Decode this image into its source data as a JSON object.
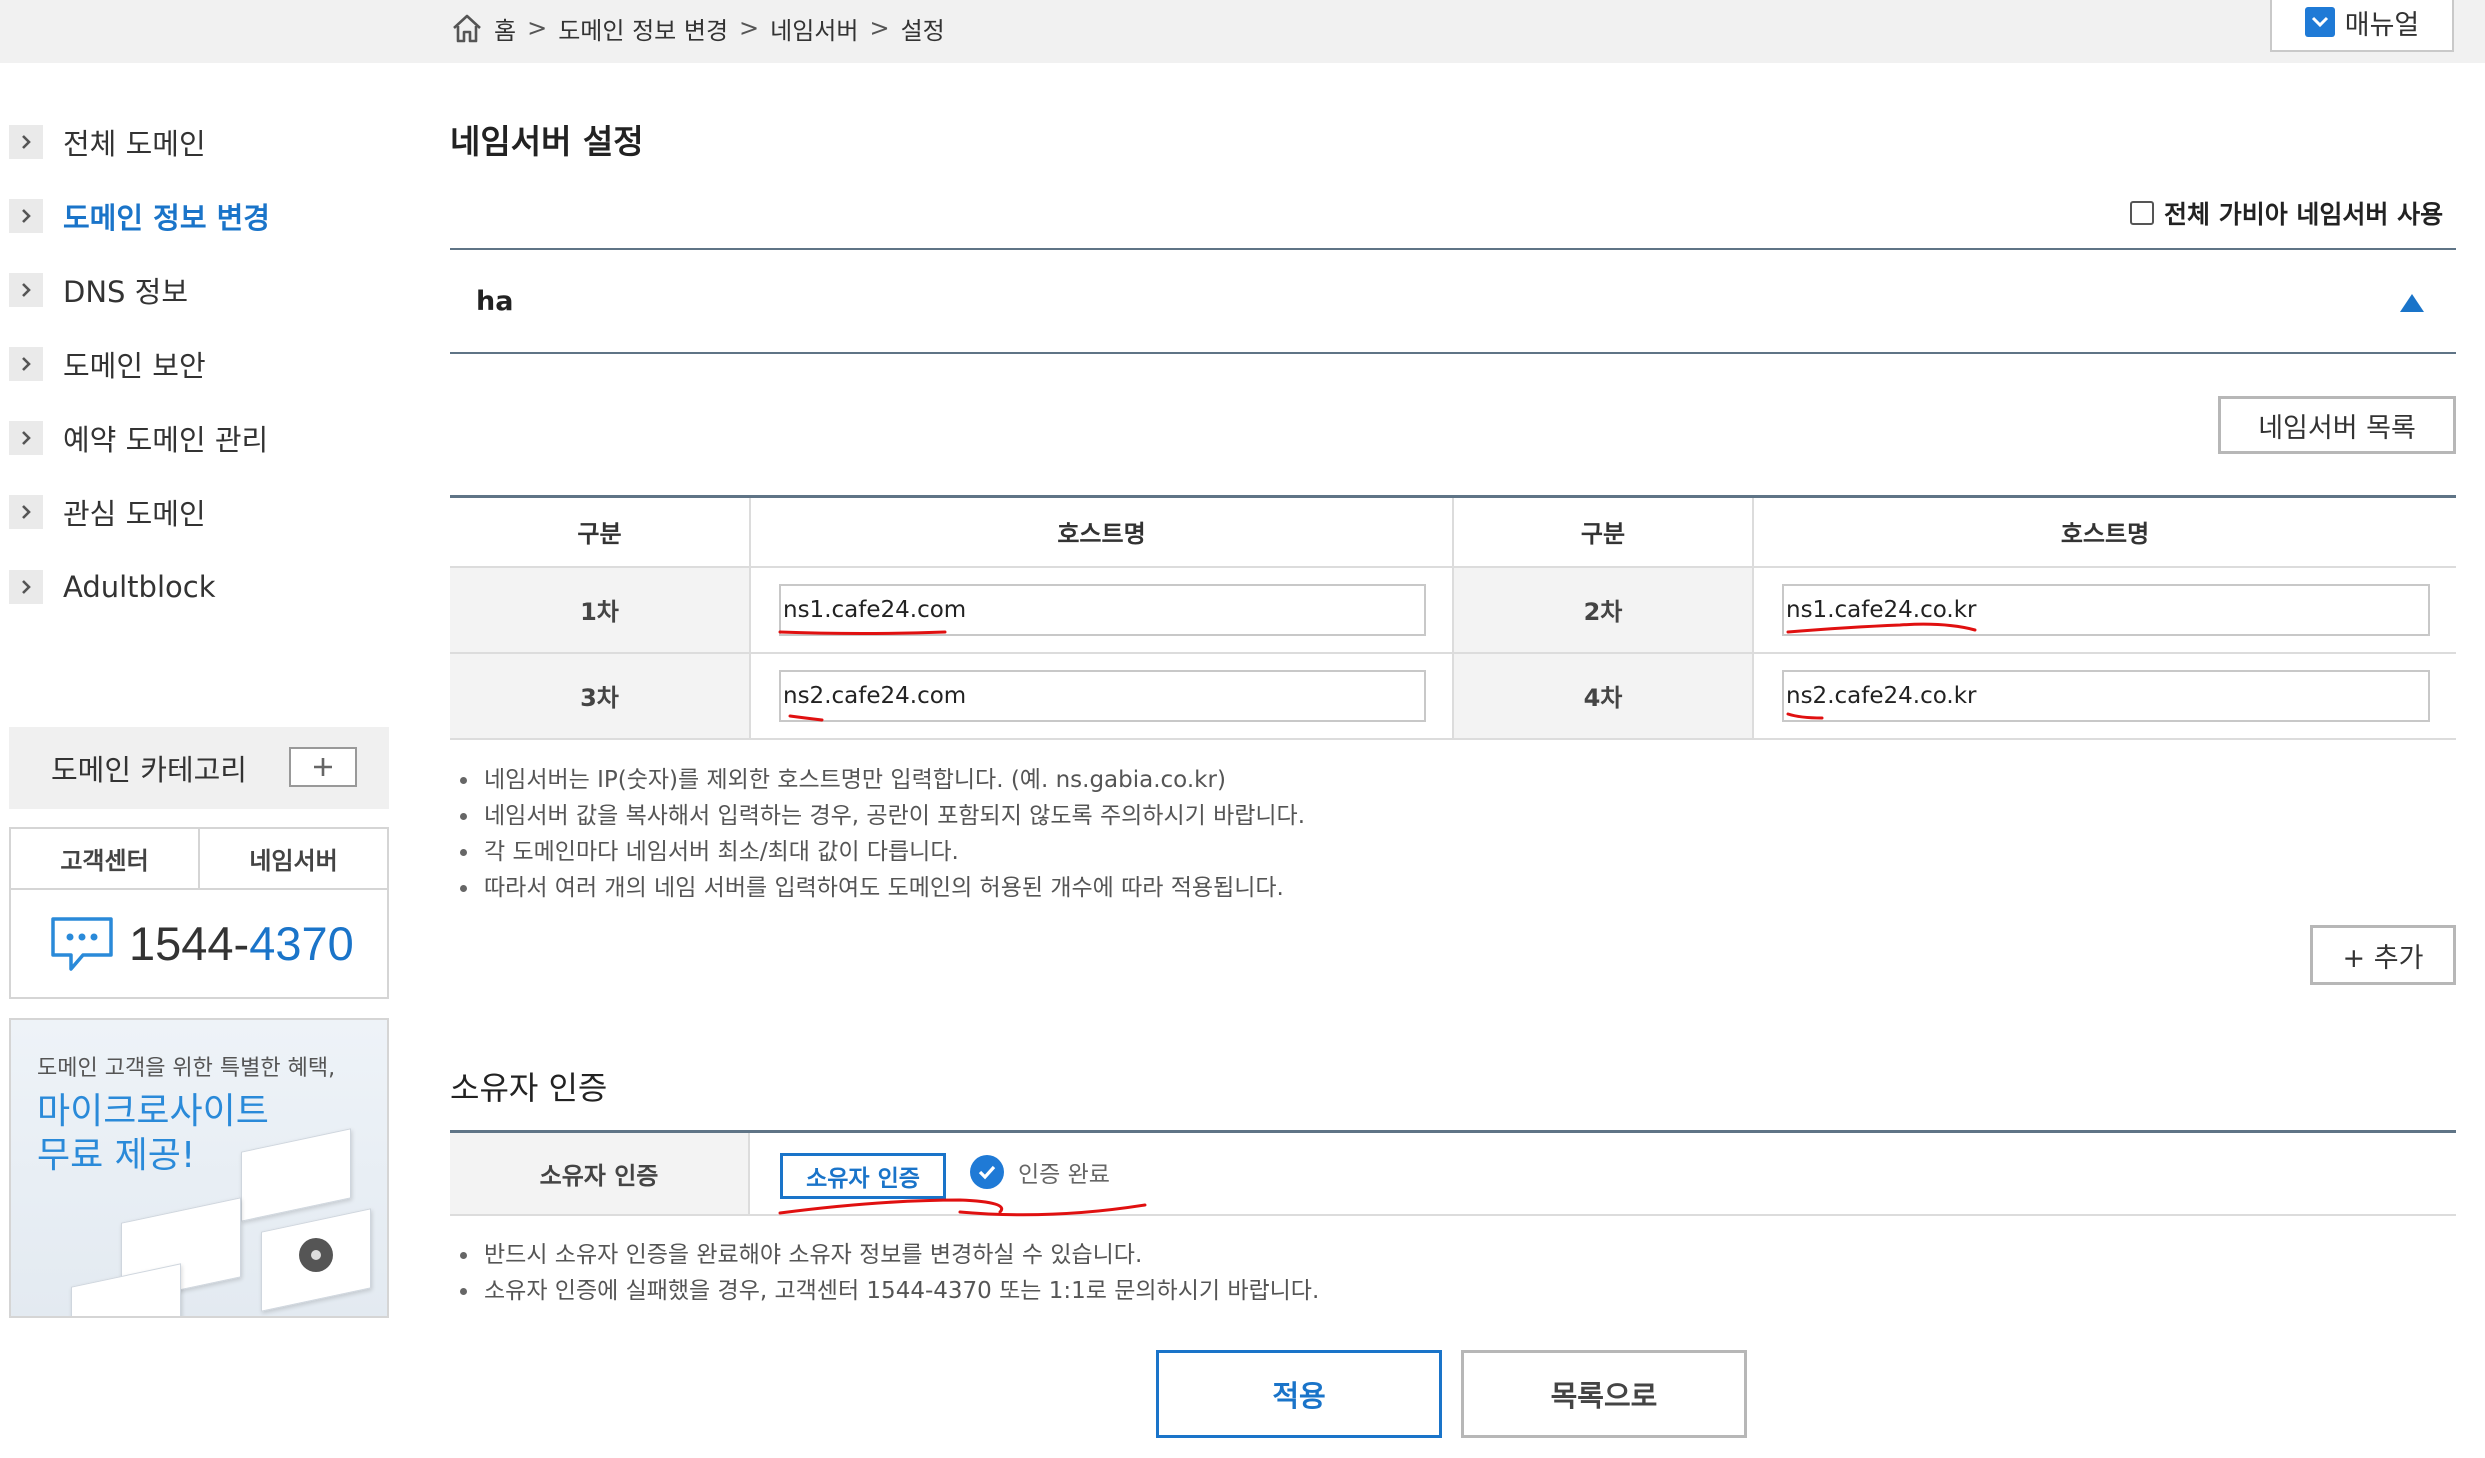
{
  "breadcrumb": {
    "home": "홈",
    "separator": ">",
    "items": [
      "도메인 정보 변경",
      "네임서버",
      "설정"
    ]
  },
  "manual_button": "매뉴얼",
  "sidebar": {
    "items": [
      {
        "label": "전체 도메인",
        "active": false
      },
      {
        "label": "도메인 정보 변경",
        "active": true
      },
      {
        "label": "DNS 정보",
        "active": false
      },
      {
        "label": "도메인 보안",
        "active": false
      },
      {
        "label": "예약 도메인 관리",
        "active": false
      },
      {
        "label": "관심 도메인",
        "active": false
      },
      {
        "label": "Adultblock",
        "active": false
      }
    ],
    "category_label": "도메인 카테고리",
    "cs_tabs": [
      "고객센터",
      "네임서버"
    ],
    "phone_prefix": "1544-",
    "phone_suffix": "4370",
    "banner_sub": "도메인 고객을 위한 특별한 혜택,",
    "banner_line1": "마이크로사이트",
    "banner_line2": "무료 제공!"
  },
  "main": {
    "title": "네임서버 설정",
    "gabia_checkbox_label": "전체 가비아 네임서버 사용",
    "gabia_checked": false,
    "domain_name_visible": "ha",
    "ns_list_button": "네임서버 목록",
    "table": {
      "headers": [
        "구분",
        "호스트명",
        "구분",
        "호스트명"
      ],
      "rows": [
        [
          {
            "label": "1차",
            "value": "ns1.cafe24.com"
          },
          {
            "label": "2차",
            "value": "ns1.cafe24.co.kr"
          }
        ],
        [
          {
            "label": "3차",
            "value": "ns2.cafe24.com"
          },
          {
            "label": "4차",
            "value": "ns2.cafe24.co.kr"
          }
        ]
      ]
    },
    "notes": [
      "네임서버는 IP(숫자)를 제외한 호스트명만 입력합니다. (예. ns.gabia.co.kr)",
      "네임서버 값을 복사해서 입력하는 경우, 공란이 포함되지 않도록 주의하시기 바랍니다.",
      "각 도메인마다 네임서버 최소/최대 값이 다릅니다.",
      "따라서 여러 개의 네임 서버를 입력하여도 도메인의 허용된 개수에 따라 적용됩니다."
    ],
    "add_button": "+ 추가"
  },
  "owner": {
    "section_title": "소유자 인증",
    "row_label": "소유자 인증",
    "verify_button": "소유자 인증",
    "status": "인증 완료",
    "notes": [
      "반드시 소유자 인증을 완료해야 소유자 정보를 변경하실 수 있습니다.",
      "소유자 인증에 실패했을 경우, 고객센터 1544-4370 또는 1:1로 문의하시기 바랍니다."
    ]
  },
  "footer": {
    "apply_button": "적용",
    "list_button": "목록으로"
  },
  "colors": {
    "accent": "#1a74c9",
    "annotation": "#e01010",
    "table_border": "#5f7486"
  }
}
